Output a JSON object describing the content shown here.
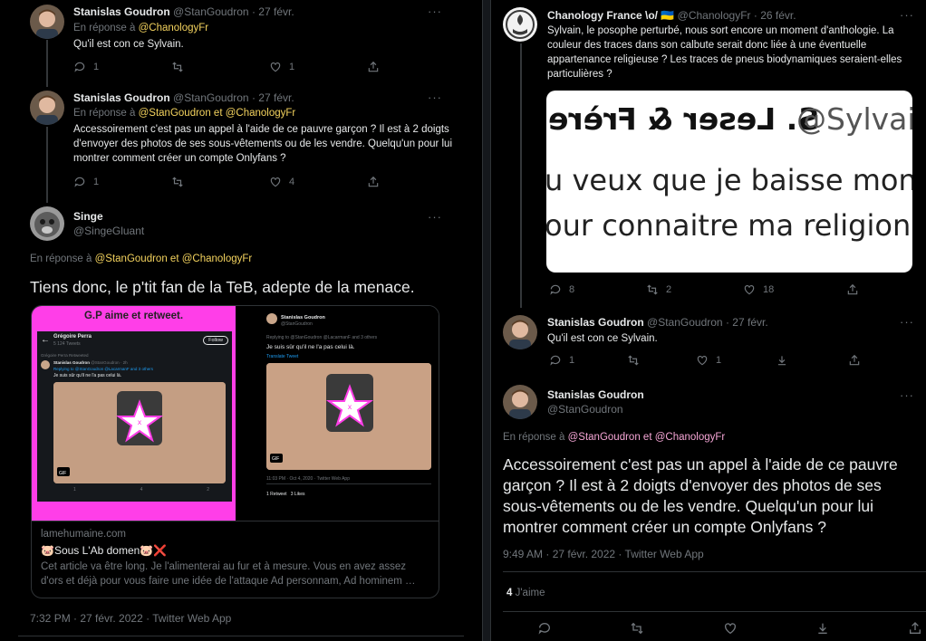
{
  "left": {
    "tweet1": {
      "name": "Stanislas Goudron",
      "handle": "@StanGoudron",
      "dot": "·",
      "date": "27 févr.",
      "reply_prefix": "En réponse à",
      "reply_to_1": "@ChanologyFr",
      "text": "Qu'il est con ce Sylvain.",
      "stats": {
        "replies": "1",
        "retweets": "",
        "likes": "1"
      }
    },
    "tweet2": {
      "name": "Stanislas Goudron",
      "handle": "@StanGoudron",
      "dot": "·",
      "date": "27 févr.",
      "reply_prefix": "En réponse à",
      "reply_to_1": "@StanGoudron",
      "reply_and": "et",
      "reply_to_2": "@ChanologyFr",
      "text": "Accessoirement c'est pas un appel à l'aide de ce pauvre garçon ? Il est à 2 doigts d'envoyer des photos de ses sous-vêtements ou de les vendre. Quelqu'un pour lui montrer comment créer un compte Onlyfans ?",
      "stats": {
        "replies": "1",
        "retweets": "",
        "likes": "4"
      }
    },
    "main": {
      "name": "Singe",
      "handle": "@SingeGluant",
      "reply_prefix": "En réponse à",
      "reply_to_1": "@StanGoudron",
      "reply_and": "et",
      "reply_to_2": "@ChanologyFr",
      "text": "Tiens donc, le p'tit fan de la TeB, adepte de la menace.",
      "card": {
        "banner": "G.P aime et retweet.",
        "domain": "lamehumaine.com",
        "title": "🐷Sous L'Ab domen🐷❌",
        "description": "Cet article va être long. Je l'alimenterai au fur et à mesure. Vous en avez assez d'ors et déjà pour vous faire une idée de l'attaque Ad personnam, Ad hominem …",
        "inner_left": {
          "profile_name": "Grégoire Perra",
          "profile_sub": "5 124 Tweets",
          "follow": "Follow",
          "retweeted": "Grégoire Perra Retweeted",
          "tw_name": "Stanislas Goudron",
          "tw_handle": "@StanGoudron · 2h",
          "tw_reply": "Replying to @StanGoudron @LacarmanF and 3 others",
          "tw_text": "Je suis sûr qu'il ne l'a pas celui là.",
          "gif": "GIF",
          "stats": [
            "1",
            "4",
            "2"
          ]
        },
        "inner_right": {
          "tw_name": "Stanislas Goudron",
          "tw_handle": "@StanGoudron",
          "tw_reply": "Replying to @StanGoudron @LacarmanF and 3 others",
          "tw_text": "Je suis sûr qu'il ne l'a pas celui là.",
          "translate": "Translate Tweet",
          "gif": "GIF",
          "meta": "11:03 PM · Oct 4, 2020 · Twitter Web App",
          "retweets": "1 Retweet",
          "likes": "3 Likes"
        }
      },
      "meta": "7:32 PM · 27 févr. 2022 · Twitter Web App"
    }
  },
  "right": {
    "tweet1": {
      "name": "Chanology France \\o/ 🇺🇦",
      "handle": "@ChanologyFr",
      "dot": "·",
      "date": "26 févr.",
      "text": "Sylvain, le posophe perturbé, nous sort encore un moment d'anthologie. La couleur des traces dans son calbute serait donc liée à une éventuelle appartenance religieuse ? Les traces de pneus biodynamiques seraient-elles particulières ?",
      "image": {
        "line1": "S. Leser & Frère",
        "line1b": "@Sylvai",
        "line2": "u veux que je baisse mon",
        "line3": "our connaitre ma religion"
      },
      "stats": {
        "replies": "8",
        "retweets": "2",
        "likes": "18"
      }
    },
    "tweet2": {
      "name": "Stanislas Goudron",
      "handle": "@StanGoudron",
      "dot": "·",
      "date": "27 févr.",
      "text": "Qu'il est con ce Sylvain.",
      "stats": {
        "replies": "1",
        "retweets": "",
        "likes": "1"
      }
    },
    "main": {
      "name": "Stanislas Goudron",
      "handle": "@StanGoudron",
      "reply_prefix": "En réponse à",
      "reply_to_1": "@StanGoudron",
      "reply_and": "et",
      "reply_to_2": "@ChanologyFr",
      "text": "Accessoirement c'est pas un appel à l'aide de ce pauvre garçon ? Il est à 2 doigts d'envoyer des photos de ses sous-vêtements ou de les vendre. Quelqu'un pour lui montrer comment créer un compte Onlyfans ?",
      "meta": "9:49 AM · 27 févr. 2022 · Twitter Web App",
      "likes_count": "4",
      "likes_label": "J'aime"
    }
  },
  "more_label": "···",
  "colors": {
    "background": "#000000",
    "muted": "#71767b",
    "mention_yellow": "#f4d35e",
    "mention_pink": "#f6a6d6",
    "card_magenta": "#ff3ee8"
  }
}
